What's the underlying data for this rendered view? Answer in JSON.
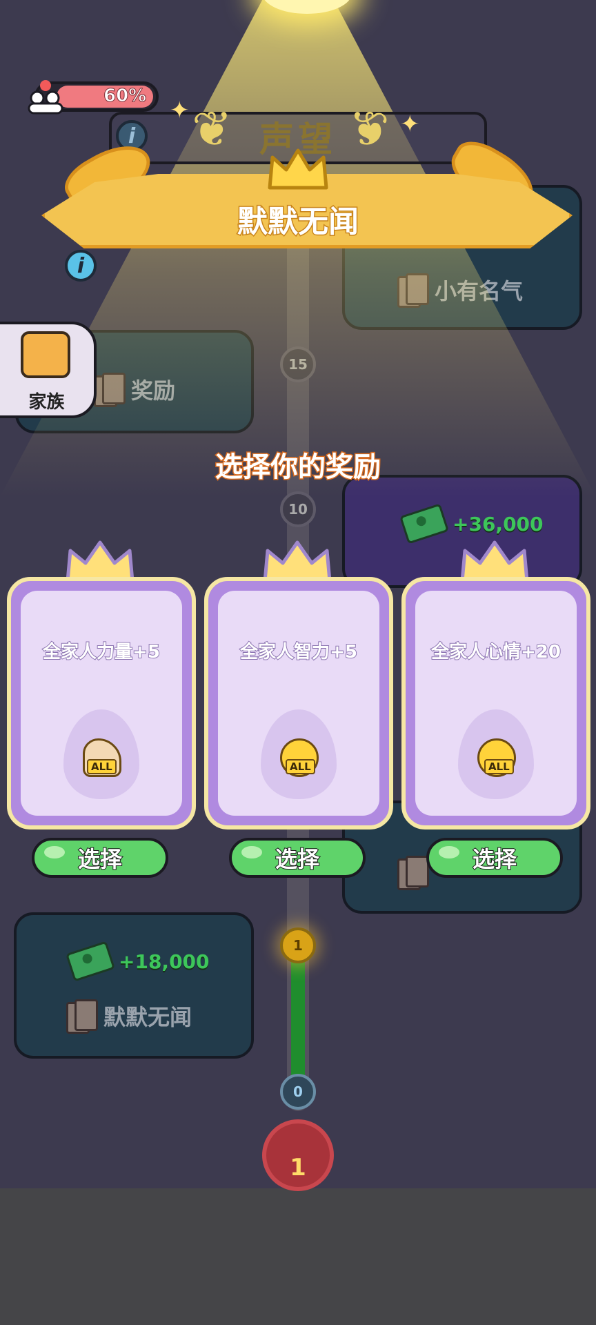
{
  "header": {
    "family_percent": "60%",
    "title": "声望",
    "rank": "默默无闻"
  },
  "milestones": [
    {
      "level": "15",
      "reward_label": "奖励"
    },
    {
      "level": "10",
      "reward_money": "+36,000"
    },
    {
      "level": "1",
      "reward_money": "+18,000",
      "reward_label": "默默无闻"
    },
    {
      "level": "0"
    }
  ],
  "right_top_bubble": {
    "reward_label": "小有名气"
  },
  "family_button": {
    "label": "家族"
  },
  "selection": {
    "title": "选择你的奖励",
    "cards": [
      {
        "text": "全家人力量+5",
        "icon": "muscle-icon",
        "badge": "ALL",
        "button": "选择"
      },
      {
        "text": "全家人智力+5",
        "icon": "lightbulb-icon",
        "badge": "ALL",
        "button": "选择"
      },
      {
        "text": "全家人心情+20",
        "icon": "smile-icon",
        "badge": "ALL",
        "button": "选择"
      }
    ]
  },
  "bottom_crown": {
    "value": "1"
  },
  "colors": {
    "background": "#3d3a4f",
    "card_purple": "#b08ae0",
    "button_green": "#5fd36a",
    "banner_gold": "#f3c451"
  }
}
